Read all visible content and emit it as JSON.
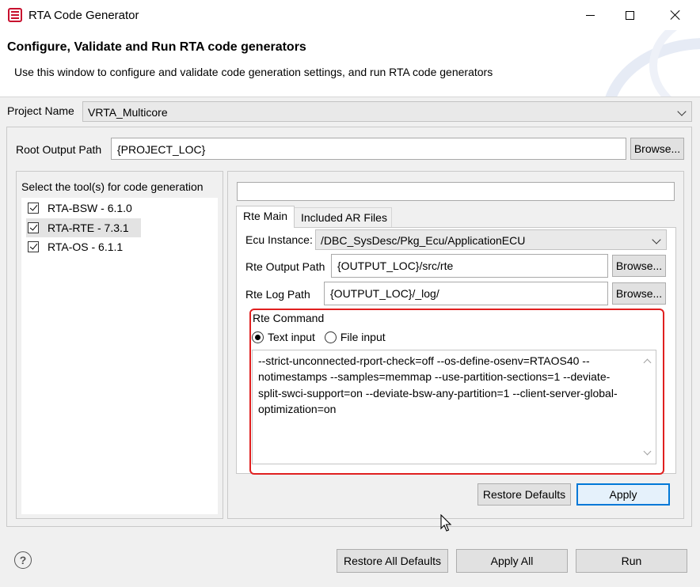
{
  "window": {
    "title": "RTA Code Generator"
  },
  "header": {
    "title": "Configure, Validate and Run RTA code generators",
    "description": "Use this window to configure and validate code generation settings, and run RTA code generators"
  },
  "project": {
    "label": "Project Name",
    "value": "VRTA_Multicore"
  },
  "root_output": {
    "label": "Root Output Path",
    "value": "{PROJECT_LOC}",
    "browse_label": "Browse..."
  },
  "tools": {
    "heading": "Select the tool(s) for code generation",
    "items": [
      {
        "label": "RTA-BSW - 6.1.0",
        "checked": true,
        "selected": false
      },
      {
        "label": "RTA-RTE - 7.3.1",
        "checked": true,
        "selected": true
      },
      {
        "label": "RTA-OS - 6.1.1",
        "checked": true,
        "selected": false
      }
    ]
  },
  "tabs": [
    {
      "label": "Rte Main",
      "active": true
    },
    {
      "label": "Included AR Files",
      "active": false
    }
  ],
  "rte": {
    "ecu_label": "Ecu Instance:",
    "ecu_value": "/DBC_SysDesc/Pkg_Ecu/ApplicationECU",
    "output_label": "Rte Output Path",
    "output_value": "{OUTPUT_LOC}/src/rte",
    "log_label": "Rte Log Path",
    "log_value": "{OUTPUT_LOC}/_log/",
    "browse_label": "Browse...",
    "command_title": "Rte Command",
    "text_input_label": "Text input",
    "file_input_label": "File input",
    "command_text": "--strict-unconnected-rport-check=off --os-define-osenv=RTAOS40 --notimestamps --samples=memmap --use-partition-sections=1 --deviate-split-swci-support=on --deviate-bsw-any-partition=1 --client-server-global-optimization=on",
    "restore_defaults_label": "Restore Defaults",
    "apply_label": "Apply"
  },
  "footer": {
    "help_label": "?",
    "restore_all_label": "Restore All Defaults",
    "apply_all_label": "Apply All",
    "run_label": "Run"
  },
  "colors": {
    "highlight_border": "#e02020",
    "primary_button_border": "#0078d7"
  }
}
